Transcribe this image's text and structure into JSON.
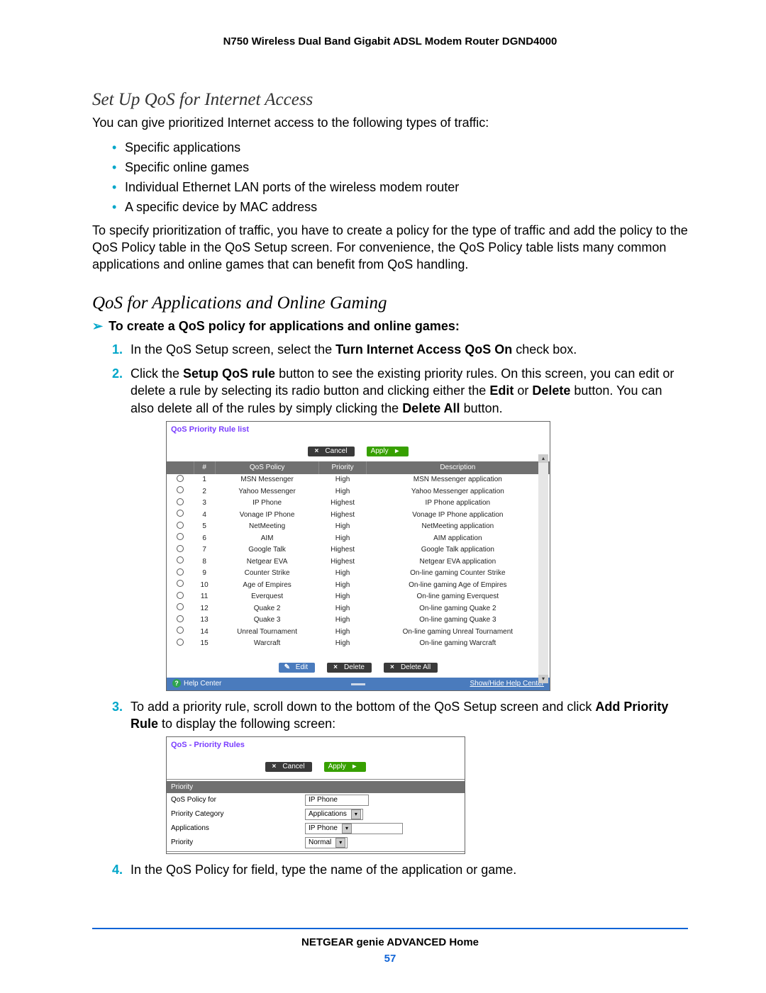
{
  "header": {
    "title": "N750 Wireless Dual Band Gigabit ADSL Modem Router DGND4000"
  },
  "section1": {
    "heading": "Set Up QoS for Internet Access"
  },
  "intro": "You can give prioritized Internet access to the following types of traffic:",
  "bullets": [
    "Specific applications",
    "Specific online games",
    "Individual Ethernet LAN ports of the wireless modem router",
    "A specific device by MAC address"
  ],
  "para2": "To specify prioritization of traffic, you have to create a policy for the type of traffic and add the policy to the QoS Policy table in the QoS Setup screen. For convenience, the QoS Policy table lists many common applications and online games that can benefit from QoS handling.",
  "section2": {
    "heading": "QoS for Applications and Online Gaming"
  },
  "proc_heading": "To create a QoS policy for applications and online games:",
  "steps": {
    "s1a": "In the QoS Setup screen, select the ",
    "s1b": "Turn Internet Access QoS On",
    "s1c": " check box.",
    "s2a": "Click the ",
    "s2b": "Setup QoS rule",
    "s2c": " button to see the existing priority rules. On this screen, you can edit or delete a rule by selecting its radio button and clicking either the ",
    "s2d": "Edit",
    "s2e": " or ",
    "s2f": "Delete",
    "s2g": " button. You can also delete all of the rules by simply clicking the ",
    "s2h": "Delete All",
    "s2i": " button.",
    "s3a": "To add a priority rule, scroll down to the bottom of the QoS Setup screen and click ",
    "s3b": "Add Priority Rule",
    "s3c": " to display the following screen:",
    "s4": "In the QoS Policy for field, type the name of the application or game."
  },
  "fig1": {
    "title": "QoS Priority Rule list",
    "buttons": {
      "cancel": "Cancel",
      "apply": "Apply",
      "edit": "Edit",
      "delete": "Delete",
      "delete_all": "Delete All"
    },
    "columns": [
      "",
      "#",
      "QoS Policy",
      "Priority",
      "Description"
    ],
    "rows": [
      {
        "n": "1",
        "policy": "MSN Messenger",
        "priority": "High",
        "desc": "MSN Messenger application"
      },
      {
        "n": "2",
        "policy": "Yahoo Messenger",
        "priority": "High",
        "desc": "Yahoo Messenger application"
      },
      {
        "n": "3",
        "policy": "IP Phone",
        "priority": "Highest",
        "desc": "IP Phone application"
      },
      {
        "n": "4",
        "policy": "Vonage IP Phone",
        "priority": "Highest",
        "desc": "Vonage IP Phone application"
      },
      {
        "n": "5",
        "policy": "NetMeeting",
        "priority": "High",
        "desc": "NetMeeting application"
      },
      {
        "n": "6",
        "policy": "AIM",
        "priority": "High",
        "desc": "AIM application"
      },
      {
        "n": "7",
        "policy": "Google Talk",
        "priority": "Highest",
        "desc": "Google Talk application"
      },
      {
        "n": "8",
        "policy": "Netgear EVA",
        "priority": "Highest",
        "desc": "Netgear EVA application"
      },
      {
        "n": "9",
        "policy": "Counter Strike",
        "priority": "High",
        "desc": "On-line gaming Counter Strike"
      },
      {
        "n": "10",
        "policy": "Age of Empires",
        "priority": "High",
        "desc": "On-line gaming Age of Empires"
      },
      {
        "n": "11",
        "policy": "Everquest",
        "priority": "High",
        "desc": "On-line gaming Everquest"
      },
      {
        "n": "12",
        "policy": "Quake 2",
        "priority": "High",
        "desc": "On-line gaming Quake 2"
      },
      {
        "n": "13",
        "policy": "Quake 3",
        "priority": "High",
        "desc": "On-line gaming Quake 3"
      },
      {
        "n": "14",
        "policy": "Unreal Tournament",
        "priority": "High",
        "desc": "On-line gaming Unreal Tournament"
      },
      {
        "n": "15",
        "policy": "Warcraft",
        "priority": "High",
        "desc": "On-line gaming Warcraft"
      }
    ],
    "help_center": "Help Center",
    "help_link": "Show/Hide Help Center"
  },
  "fig2": {
    "title": "QoS - Priority Rules",
    "buttons": {
      "cancel": "Cancel",
      "apply": "Apply"
    },
    "section_label": "Priority",
    "rows": {
      "policy_for_label": "QoS Policy for",
      "policy_for_value": "IP Phone",
      "category_label": "Priority Category",
      "category_value": "Applications",
      "apps_label": "Applications",
      "apps_value": "IP Phone",
      "priority_label": "Priority",
      "priority_value": "Normal"
    }
  },
  "footer": {
    "label": "NETGEAR genie ADVANCED Home",
    "page": "57"
  }
}
